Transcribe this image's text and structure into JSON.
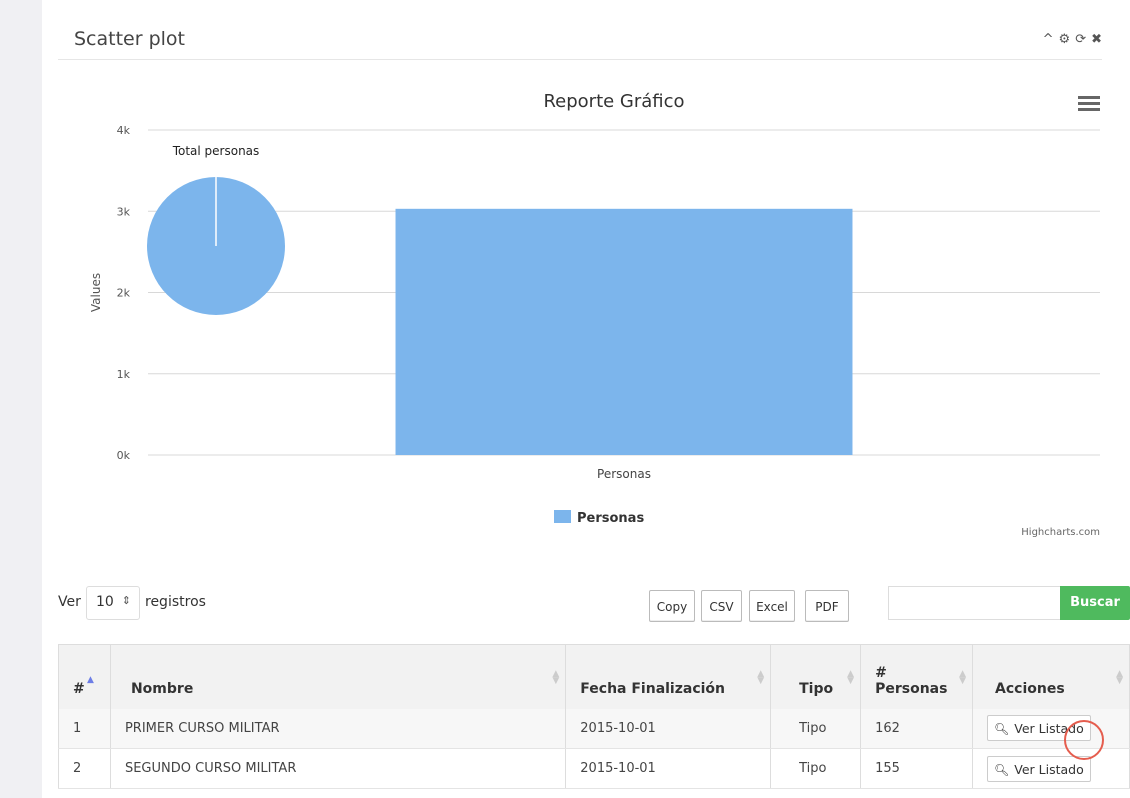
{
  "panel": {
    "title": "Scatter plot",
    "tools": {
      "collapse": "^",
      "settings": "⚙",
      "refresh": "⟳",
      "close": "✖"
    }
  },
  "chart_data": {
    "type": "bar",
    "title": "Reporte Gráfico",
    "categories": [
      "Personas"
    ],
    "series": [
      {
        "name": "Personas",
        "values": [
          3030
        ],
        "color": "#7cb5ec"
      }
    ],
    "ylabel": "Values",
    "xlabel": "",
    "ylim": [
      0,
      4000
    ],
    "ticks": [
      "0k",
      "1k",
      "2k",
      "3k",
      "4k"
    ],
    "tick_values": [
      0,
      1000,
      2000,
      3000,
      4000
    ],
    "grid": true,
    "legend": "bottom-center",
    "credits": "Highcharts.com",
    "inset_pie": {
      "title": "Total personas",
      "slices": [
        {
          "name": "Personas",
          "value": 100,
          "color": "#7cb5ec"
        }
      ]
    },
    "menu_icon": "hamburger-icon"
  },
  "controls": {
    "length_prefix": "Ver",
    "length_value": "10",
    "length_suffix": "registros",
    "export_buttons": [
      "Copy",
      "CSV",
      "Excel",
      "PDF"
    ],
    "search_button": "Buscar",
    "search_placeholder": ""
  },
  "table": {
    "headers": [
      "#",
      "Nombre",
      "Fecha Finalización",
      "Tipo",
      "# Personas",
      "Acciones"
    ],
    "rows": [
      {
        "num": "1",
        "nombre": "PRIMER CURSO MILITAR",
        "fecha": "2015-10-01",
        "tipo": "Tipo",
        "personas": "162",
        "accion": "Ver Listado"
      },
      {
        "num": "2",
        "nombre": "SEGUNDO CURSO MILITAR",
        "fecha": "2015-10-01",
        "tipo": "Tipo",
        "personas": "155",
        "accion": "Ver Listado"
      }
    ]
  },
  "colors": {
    "accent_green": "#4fba5e",
    "bar_blue": "#7cb5ec",
    "sort_active": "#6d7ee6"
  }
}
